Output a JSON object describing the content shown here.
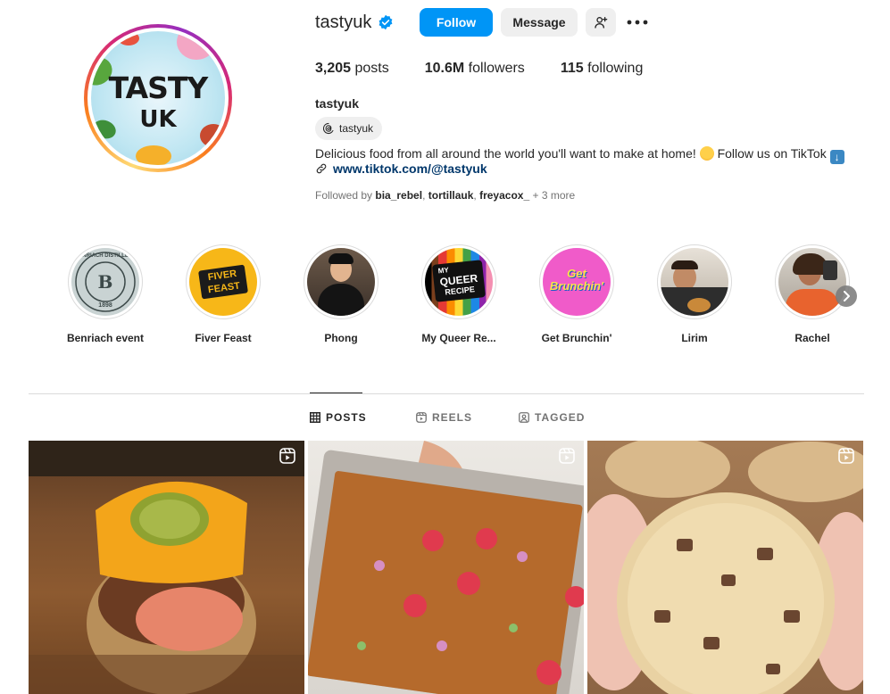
{
  "profile": {
    "username": "tastyuk",
    "full_name": "tastyuk",
    "avatar_text_line1": "TASTY",
    "avatar_text_line2": "UK",
    "verified_icon": "verified-badge-icon",
    "follow_label": "Follow",
    "message_label": "Message",
    "stats": {
      "posts_count": "3,205",
      "posts_label": "posts",
      "followers_count": "10.6M",
      "followers_label": "followers",
      "following_count": "115",
      "following_label": "following"
    },
    "threads_handle": "tastyuk",
    "bio": "Delicious food from all around the world you'll want to make at home!",
    "bio_follow": "Follow us on TikTok",
    "link": "www.tiktok.com/@tastyuk",
    "followed_by_prefix": "Followed by",
    "followed_by": [
      "bia_rebel",
      "tortillauk",
      "freyacox_"
    ],
    "followed_by_more": "+ 3 more"
  },
  "highlights": [
    {
      "label": "Benriach event",
      "seal_text": "BENRIACH DISTILLERY",
      "year": "1898"
    },
    {
      "label": "Fiver Feast",
      "badge_line1": "FIVER",
      "badge_line2": "FEAST"
    },
    {
      "label": "Phong"
    },
    {
      "label": "My Queer Re...",
      "badge_line1": "MY",
      "badge_line2": "QUEER",
      "badge_line3": "RECIPE"
    },
    {
      "label": "Get Brunchin'",
      "badge_line1": "Get",
      "badge_line2": "Brunchin'"
    },
    {
      "label": "Lirim"
    },
    {
      "label": "Rachel"
    }
  ],
  "tabs": [
    {
      "label": "POSTS",
      "active": true,
      "icon": "grid-icon"
    },
    {
      "label": "REELS",
      "active": false,
      "icon": "reels-icon"
    },
    {
      "label": "TAGGED",
      "active": false,
      "icon": "tagged-icon"
    }
  ],
  "posts": [
    {
      "subject": "cheeseburger-stuffed-potato",
      "type": "reel"
    },
    {
      "subject": "croissant-bake-with-raspberries",
      "type": "reel"
    },
    {
      "subject": "chocolate-chip-cookie",
      "type": "reel"
    }
  ],
  "colors": {
    "primary_blue": "#0095f6",
    "link_blue": "#00376b",
    "secondary_button": "#efefef",
    "text": "#262626",
    "muted_text": "#737373",
    "divider": "#dbdbdb"
  }
}
